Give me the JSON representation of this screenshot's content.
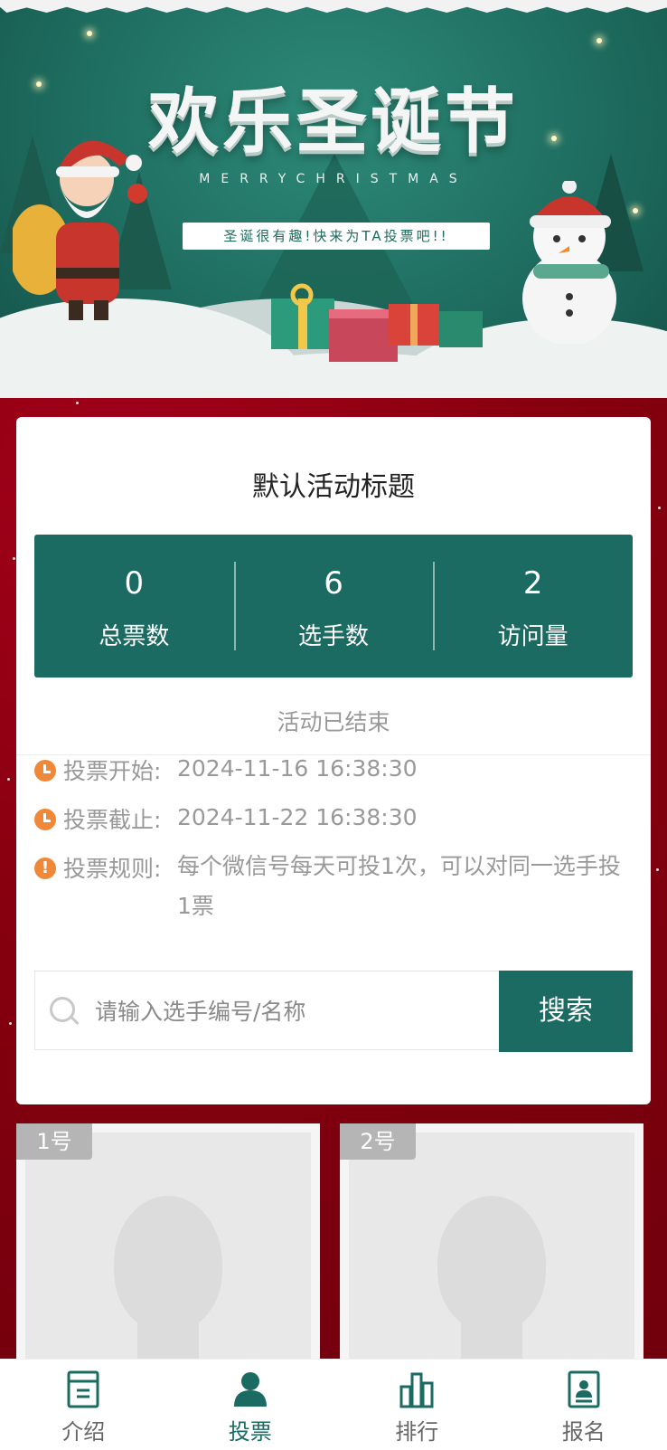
{
  "banner": {
    "title": "欢乐圣诞节",
    "subtitle": "MERRYCHRISTMAS",
    "tagline": "圣诞很有趣!快来为TA投票吧!!"
  },
  "activity": {
    "title": "默认活动标题",
    "stats": [
      {
        "value": "0",
        "label": "总票数"
      },
      {
        "value": "6",
        "label": "选手数"
      },
      {
        "value": "2",
        "label": "访问量"
      }
    ],
    "status": "活动已结束",
    "start_label": "投票开始:",
    "start_value": "2024-11-16 16:38:30",
    "end_label": "投票截止:",
    "end_value": "2024-11-22 16:38:30",
    "rules_label": "投票规则:",
    "rules_value": "每个微信号每天可投1次，可以对同一选手投1票"
  },
  "search": {
    "placeholder": "请输入选手编号/名称",
    "button_label": "搜索"
  },
  "contestants": [
    {
      "badge": "1号"
    },
    {
      "badge": "2号"
    }
  ],
  "tabbar": {
    "items": [
      {
        "label": "介绍",
        "icon": "document-icon"
      },
      {
        "label": "投票",
        "icon": "person-icon"
      },
      {
        "label": "排行",
        "icon": "bar-chart-icon"
      },
      {
        "label": "报名",
        "icon": "id-card-icon"
      }
    ],
    "active": "投票"
  },
  "colors": {
    "primary": "#1b6b62",
    "background": "#8a0012",
    "accent_icon": "#f0883a"
  }
}
